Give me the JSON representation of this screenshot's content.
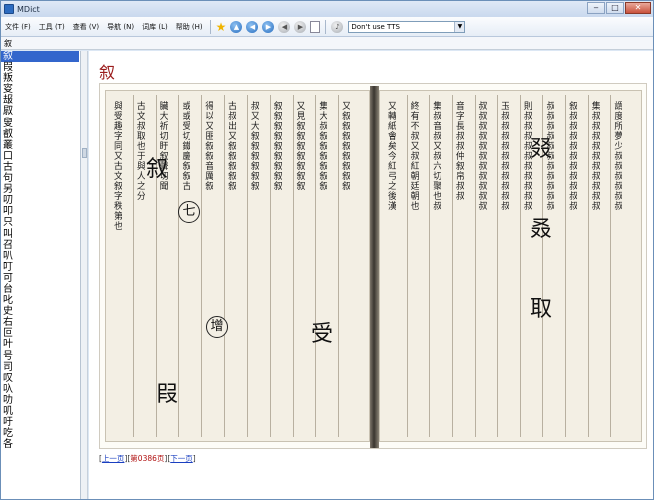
{
  "window": {
    "title": "MDict"
  },
  "menu": {
    "items": [
      "文件 (F)",
      "工具 (T)",
      "查看 (V)",
      "导航 (N)",
      "词库 (L)",
      "帮助 (H)"
    ]
  },
  "toolbar": {
    "icons": [
      "star-icon",
      "home-icon",
      "back-icon",
      "forward-icon",
      "back-history-icon",
      "forward-history-icon",
      "copy-icon",
      "speaker-icon"
    ],
    "tts_value": "Don't use TTS"
  },
  "search": {
    "value": "叙"
  },
  "wordlist": {
    "items": [
      "叙",
      "叚",
      "叛",
      "叜",
      "叝",
      "叞",
      "叟",
      "叡",
      "叢",
      "口",
      "古",
      "句",
      "另",
      "叨",
      "叩",
      "只",
      "叫",
      "召",
      "叭",
      "叮",
      "可",
      "台",
      "叱",
      "史",
      "右",
      "叵",
      "叶",
      "号",
      "司",
      "叹",
      "叺",
      "叻",
      "叽",
      "吁",
      "吃",
      "各"
    ],
    "selected_index": 0
  },
  "entry": {
    "headword": "叙",
    "page_nav": {
      "prev": "上一页",
      "current": "第0386页",
      "next": "下一页"
    }
  },
  "scan": {
    "left_columns": [
      "與受趣字同又古文叙字秩第也",
      "古文叔取也于與人之分",
      "臟大祈切盱叙聲切聞",
      "或或受切鐵慶叙叙古",
      "得以又匪叙叙音厲叙",
      "古叔出又叙叙叙叙叙",
      "叔又大叙叙叙叙叙叙",
      "叙叙叙叙叙叙叙叙叙",
      "又見叙叙叙叙叙叙叙",
      "集大叔叙叙叙叙叙叙",
      "又叙叙叙叙叙叙叙叙"
    ],
    "right_columns": [
      "又轉紙會矣今紅弓之後漢",
      "終有不叔又叔紅朝廷朝也",
      "集叔音叔又叔六切聚也叔",
      "音字長叔叔仲叙帛叔叔",
      "叔叔叔叔叔叔叔叔叔叔叔",
      "玉叔叔叔叔叔叔叔叔叔叔",
      "則叔叔叔叔叔叔叔叔叔叔",
      "叔叔叔叔叔叔叔叔叔叔叔",
      "叙叔叔叔叔叔叔叔叔叔叔",
      "集叔叔叔叔叔叔叔叔叔叔",
      "謂度所夢少叔叔叔叔叔叔"
    ],
    "left_big": [
      "叙",
      "受",
      "叚"
    ],
    "right_big": [
      "叕",
      "叒",
      "取"
    ],
    "left_circled": [
      "七",
      "增"
    ],
    "right_circled": []
  }
}
